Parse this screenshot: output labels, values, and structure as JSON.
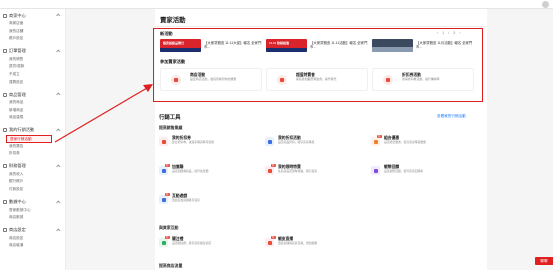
{
  "sidebar": {
    "sections": [
      {
        "title": "商家中心",
        "items": [
          "商家店面",
          "我的店舖",
          "帳戶設定"
        ]
      },
      {
        "title": "訂單管理",
        "items": [
          "我的銷售",
          "退貨/退款",
          "不成立",
          "運費設定"
        ]
      },
      {
        "title": "商品管理",
        "items": [
          "我的商品",
          "新增商品",
          "商品違規"
        ]
      },
      {
        "title": "我的行銷活動",
        "items": [
          "賣家行銷活動",
          "我的廣告",
          "折扣券"
        ]
      },
      {
        "title": "財務管理",
        "items": [
          "我的收入",
          "銀行帳戶",
          "付款設定"
        ]
      },
      {
        "title": "數據中心",
        "items": [
          "賣家數據中心",
          "商店數據"
        ]
      },
      {
        "title": "商店設定",
        "items": [
          "商店設定",
          "商店裝潢"
        ]
      }
    ],
    "active_item": "賣家行銷活動"
  },
  "main": {
    "page_title": "賣家活動",
    "new_activities": {
      "title": "新活動",
      "pager": [
        "‹",
        "1",
        "/",
        "3",
        "›"
      ],
      "banners": [
        {
          "thumb_text": "蝦皮超級品牌日",
          "title": "【大家幫蝦皮 11.11大促】報名 全家門市..."
        },
        {
          "thumb_text": "11.11 熱銷超值",
          "title": "【大家幫蝦皮 11.11活動】報名 全家門市..."
        },
        {
          "thumb_text": "",
          "title": "【大家幫蝦皮 11月活動】報名 全家門市..."
        }
      ]
    },
    "join_activities": {
      "title": "參加賣家活動",
      "cards": [
        {
          "name": "商店活動",
          "desc": "設定商店活動，讓買家看到你的優惠"
        },
        {
          "name": "超值特賣會",
          "desc": "報名參加蝦皮特賣會，提升曝光"
        },
        {
          "name": "折扣券活動",
          "desc": "參與折扣券活動，提升轉換率"
        }
      ]
    },
    "tools": {
      "title": "行銷工具",
      "link": "查看我的行銷活動",
      "groups": [
        {
          "title": "提高銷售業績",
          "items": [
            {
              "name": "我的折扣券",
              "desc": "建立折扣券，讓買家購買時可使用",
              "badge": "",
              "icon": "coupon-icon"
            },
            {
              "name": "我的折扣活動",
              "desc": "設定商品折扣，吸引買家購買",
              "badge": "",
              "icon": "discount-icon"
            },
            {
              "name": "組合優惠",
              "desc": "設定組合優惠，提高買家購買數量",
              "badge": "新",
              "icon": "bundle-icon"
            },
            {
              "name": "加價購",
              "desc": "設定加價購商品，提升客單價",
              "badge": "新",
              "icon": "addon-icon"
            },
            {
              "name": "我的限時特賣",
              "desc": "在商店設定限時特賣，吸引買家",
              "badge": "新",
              "icon": "flash-sale-icon"
            },
            {
              "name": "蝦幣回饋",
              "desc": "設定蝦幣回饋，提升買家回購率",
              "badge": "",
              "icon": "coin-icon"
            },
            {
              "name": "互動遊戲",
              "desc": "透過互動遊戲吸引買家",
              "badge": "新",
              "icon": "game-icon"
            }
          ]
        },
        {
          "title": "與買家互動",
          "items": [
            {
              "name": "關注禮",
              "desc": "設定關注禮，吸引買家關注商店",
              "badge": "新",
              "icon": "follow-prize-icon"
            },
            {
              "name": "蝦皮直播",
              "desc": "透過直播與買家互動，增加銷量",
              "badge": "新",
              "icon": "live-icon"
            }
          ]
        },
        {
          "title": "提高商店流量",
          "items": []
        }
      ]
    }
  },
  "float_button": "聊聊",
  "colors": {
    "accent": "#e02020",
    "link": "#1677ff"
  }
}
